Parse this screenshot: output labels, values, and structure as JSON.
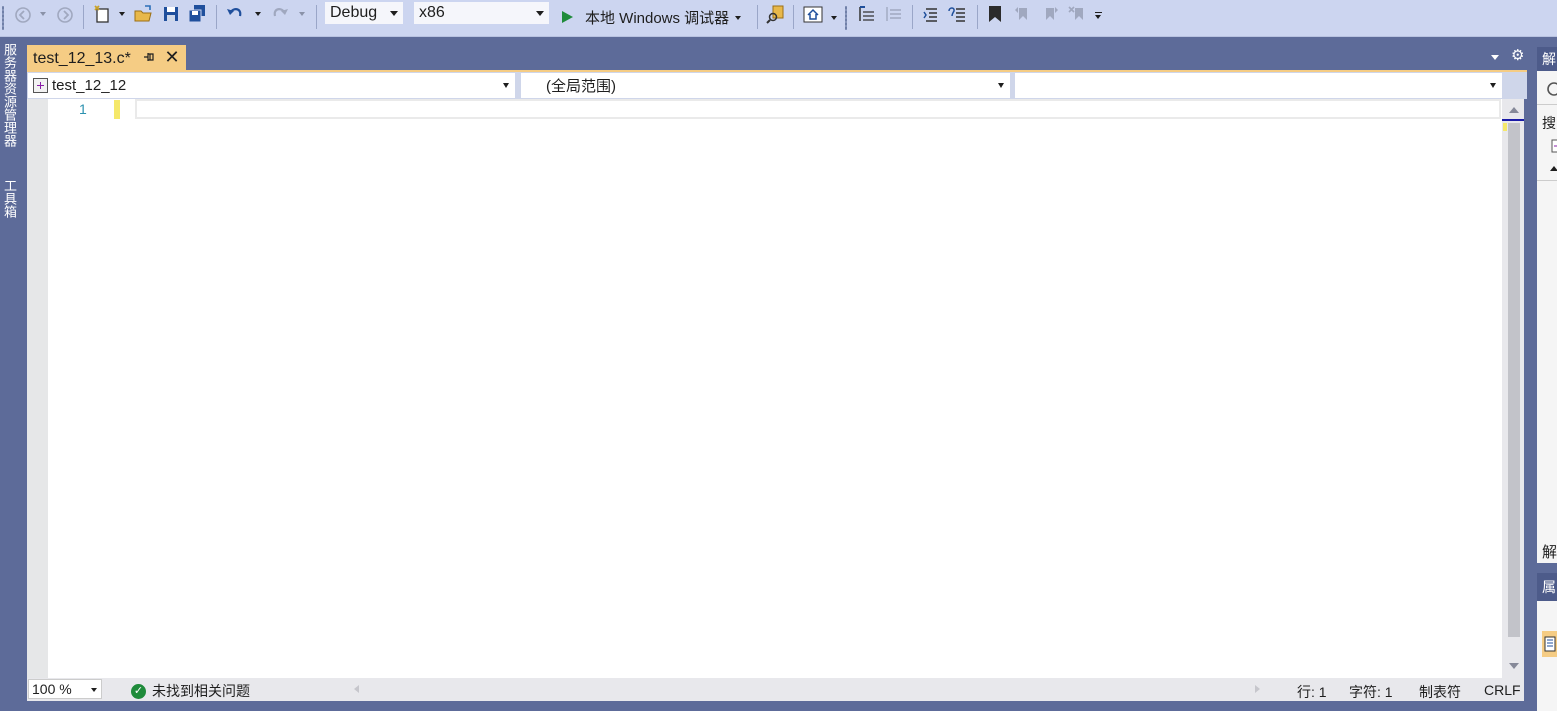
{
  "toolbar": {
    "configuration": "Debug",
    "platform": "x86",
    "run_label": "本地 Windows 调试器",
    "icons": [
      "back-icon",
      "forward-icon",
      "new-project-icon",
      "open-file-icon",
      "save-icon",
      "save-all-icon",
      "undo-icon",
      "redo-icon",
      "play-icon",
      "find-in-files-icon",
      "solution-explorer-icon",
      "step-over-icon",
      "comment-icon",
      "uncomment-icon",
      "bookmark-icon",
      "prev-bookmark-icon",
      "next-bookmark-icon",
      "clear-bookmarks-icon"
    ]
  },
  "left_tool_windows": [
    "服务器资源管理器",
    "工具箱"
  ],
  "document_tab": {
    "title": "test_12_13.c*",
    "close_glyph": "✕"
  },
  "navigation_bar": {
    "project": "test_12_12",
    "scope": "(全局范围)",
    "member": ""
  },
  "editor": {
    "line_numbers": [
      "1"
    ],
    "code": ""
  },
  "status": {
    "zoom": "100 %",
    "issues": "未找到相关问题",
    "line": "行: 1",
    "char": "字符: 1",
    "mode": "制表符",
    "eol": "CRLF"
  },
  "right_panel": {
    "solution_explorer_title": "解",
    "search_placeholder": "搜",
    "solution_explorer_title2": "解",
    "properties_title": "属"
  },
  "colors": {
    "toolbar_bg": "#ccd5f0",
    "chrome_bg": "#5d6b99",
    "active_tab": "#f5cc84",
    "line_number": "#2b91af",
    "run_green": "#1f8b3b"
  }
}
